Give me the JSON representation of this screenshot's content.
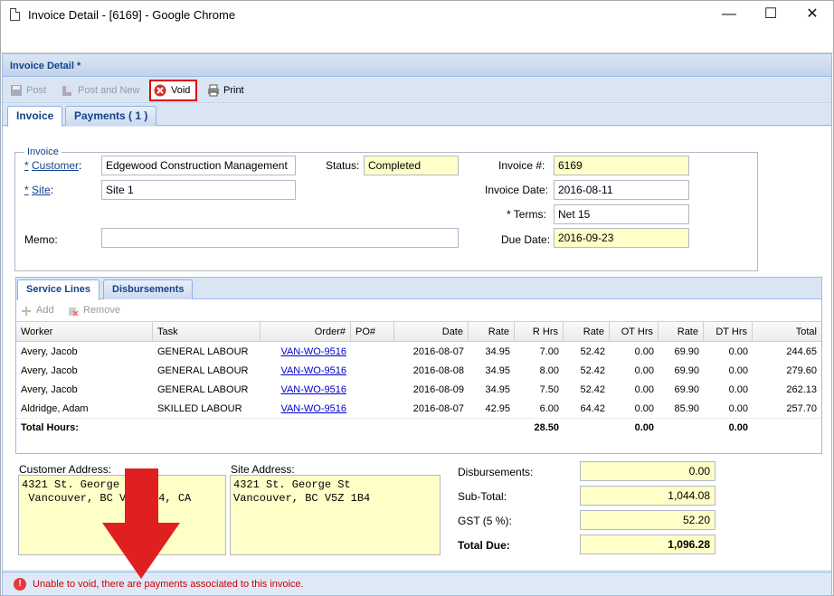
{
  "window": {
    "title": "Invoice Detail - [6169] - Google Chrome",
    "minimize": "—",
    "maximize": "☐",
    "close": "✕"
  },
  "panel": {
    "title": "Invoice Detail *"
  },
  "toolbar": {
    "post": "Post",
    "post_and_new": "Post and New",
    "void": "Void",
    "print": "Print"
  },
  "tabs": [
    "Invoice",
    "Payments ( 1 )"
  ],
  "invoice": {
    "legend": "Invoice",
    "customer_label": "Customer",
    "customer_required": "*",
    "customer_value": "Edgewood Construction Management",
    "site_label": "Site",
    "site_required": "*",
    "site_value": "Site 1",
    "memo_label": "Memo:",
    "memo_value": "",
    "status_label": "Status:",
    "status_value": "Completed",
    "invoice_no_label": "Invoice #:",
    "invoice_no_value": "6169",
    "invoice_date_label": "Invoice Date:",
    "invoice_date_value": "2016-08-11",
    "terms_label": "* Terms:",
    "terms_value": "Net 15",
    "due_date_label": "Due Date:",
    "due_date_value": "2016-09-23"
  },
  "grid": {
    "tabs": [
      "Service Lines",
      "Disbursements"
    ],
    "add": "Add",
    "remove": "Remove",
    "columns": [
      "Worker",
      "Task",
      "Order#",
      "PO#",
      "Date",
      "Rate",
      "R Hrs",
      "Rate",
      "OT Hrs",
      "Rate",
      "DT Hrs",
      "Total"
    ],
    "rows": [
      [
        "Avery, Jacob",
        "GENERAL LABOUR",
        "VAN-WO-9516",
        "",
        "2016-08-07",
        "34.95",
        "7.00",
        "52.42",
        "0.00",
        "69.90",
        "0.00",
        "244.65"
      ],
      [
        "Avery, Jacob",
        "GENERAL LABOUR",
        "VAN-WO-9516",
        "",
        "2016-08-08",
        "34.95",
        "8.00",
        "52.42",
        "0.00",
        "69.90",
        "0.00",
        "279.60"
      ],
      [
        "Avery, Jacob",
        "GENERAL LABOUR",
        "VAN-WO-9516",
        "",
        "2016-08-09",
        "34.95",
        "7.50",
        "52.42",
        "0.00",
        "69.90",
        "0.00",
        "262.13"
      ],
      [
        "Aldridge, Adam",
        "SKILLED LABOUR",
        "VAN-WO-9516",
        "",
        "2016-08-07",
        "42.95",
        "6.00",
        "64.42",
        "0.00",
        "85.90",
        "0.00",
        "257.70"
      ]
    ],
    "total_label": "Total Hours:",
    "total_rhrs": "28.50",
    "total_othrs": "0.00",
    "total_dthrs": "0.00"
  },
  "addresses": {
    "customer_label": "Customer Address:",
    "customer_value": "4321 St. George St\n Vancouver, BC V5Z 1B4, CA",
    "site_label": "Site Address:",
    "site_value": "4321 St. George St\nVancouver, BC V5Z 1B4"
  },
  "summary": {
    "disbursements_label": "Disbursements:",
    "disbursements_value": "0.00",
    "subtotal_label": "Sub-Total:",
    "subtotal_value": "1,044.08",
    "gst_label": "GST (5 %):",
    "gst_value": "52.20",
    "total_label": "Total Due:",
    "total_value": "1,096.28"
  },
  "status_bar": {
    "icon": "!",
    "message": "Unable to void, there are payments associated to this invoice."
  },
  "colors": {
    "accent": "#15428b",
    "error": "#cc0000",
    "highlight": "#ffffc8",
    "arrow": "#e02020"
  }
}
